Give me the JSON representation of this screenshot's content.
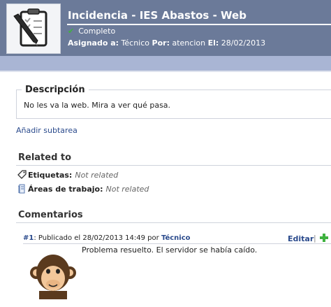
{
  "header": {
    "title": "Incidencia - IES Abastos - Web",
    "status": "Completo",
    "assigned_label": "Asignado a:",
    "assigned_value": "Técnico",
    "by_label": "Por:",
    "by_value": "atencion",
    "date_label": "El:",
    "date_value": "28/02/2013"
  },
  "description": {
    "legend": "Descripción",
    "text": "No les va la web. Mira a ver qué pasa."
  },
  "add_subtask": "Añadir subtarea",
  "related": {
    "title": "Related to",
    "tags_label": "Etiquetas:",
    "tags_value": "Not related",
    "areas_label": "Áreas de trabajo:",
    "areas_value": "Not related"
  },
  "comments": {
    "title": "Comentarios",
    "items": [
      {
        "num": "#1",
        "published_prefix": ": Publicado el 28/02/2013 14:49 por",
        "author": "Técnico",
        "text": "Problema resuelto. El servidor se había caído.",
        "edit_label": "Editar",
        "separator": "|"
      }
    ]
  },
  "colors": {
    "header_bg": "#6b7a99",
    "band_bg": "#a9b5d4",
    "link": "#2a4a8c",
    "check": "#3fb23f"
  },
  "icons": {
    "header": "clipboard-pen-icon",
    "status": "check-icon",
    "tags": "tag-icon",
    "areas": "document-icon",
    "add": "plus-icon"
  }
}
